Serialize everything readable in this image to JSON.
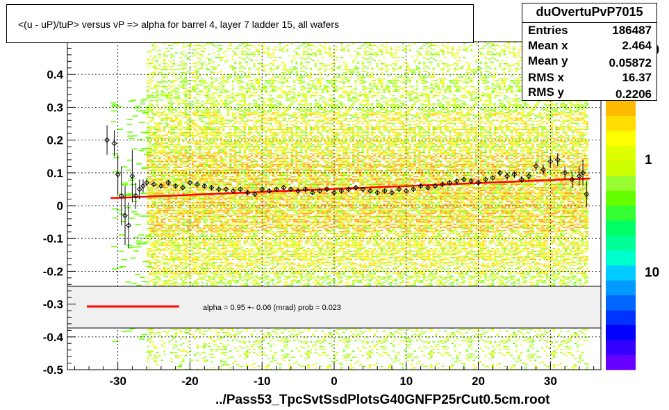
{
  "title": "<(u - uP)/tuP> versus   vP => alpha for barrel 4, layer 7 ladder 15, all wafers",
  "footer": "../Pass53_TpcSvtSsdPlotsG40GNFP25rCut0.5cm.root",
  "stats": {
    "name": "duOvertuPvP7015",
    "rows": [
      {
        "label": "Entries",
        "value": "186487"
      },
      {
        "label": "Mean x",
        "value": "2.464"
      },
      {
        "label": "Mean y",
        "value": "0.05872"
      },
      {
        "label": "RMS x",
        "value": "16.37"
      },
      {
        "label": "RMS y",
        "value": "0.2206"
      }
    ]
  },
  "legend": {
    "text": "alpha =    0.95 +-  0.06 (mrad) prob = 0.023",
    "line_color": "#ff0000"
  },
  "colorbar": {
    "labels": [
      "10",
      "1",
      "10"
    ],
    "colors": [
      "#6600ff",
      "#3300ff",
      "#0000ff",
      "#0033ff",
      "#0066ff",
      "#0099ff",
      "#00ccff",
      "#00ffcc",
      "#00ff99",
      "#00ff66",
      "#33ff33",
      "#66ff00",
      "#99ff33",
      "#ccff00",
      "#ddff00",
      "#ffff00",
      "#ffdd00",
      "#ffbb00"
    ]
  },
  "chart_data": {
    "type": "heatmap",
    "xlim": [
      -37,
      37
    ],
    "ylim": [
      -0.5,
      0.5
    ],
    "x_ticks": [
      -30,
      -20,
      -10,
      0,
      10,
      20,
      30
    ],
    "y_ticks": [
      -0.5,
      -0.4,
      -0.3,
      -0.2,
      -0.1,
      0,
      0.1,
      0.2,
      0.3,
      0.4
    ],
    "x_tick_labels": [
      "-30",
      "-20",
      "-10",
      "0",
      "10",
      "20",
      "30"
    ],
    "y_tick_labels": [
      "-0.5",
      "-0.4",
      "-0.3",
      "-0.2",
      "-0.1",
      "0",
      "0.1",
      "0.2",
      "0.3",
      "0.4"
    ],
    "grid": true,
    "heatmap_x_range": [
      -26,
      35
    ],
    "fit_line": {
      "x": [
        -31,
        35.5
      ],
      "y": [
        0.023,
        0.083
      ],
      "color": "#ff0000"
    },
    "profile": {
      "x": [
        -31.5,
        -30.5,
        -30,
        -29.5,
        -29,
        -28.5,
        -28,
        -27.5,
        -27,
        -26.5,
        -26,
        -25,
        -24,
        -23,
        -22,
        -21,
        -20,
        -19,
        -18,
        -17,
        -16,
        -15,
        -14,
        -13,
        -12,
        -11,
        -10,
        -9,
        -8,
        -7,
        -6,
        -5,
        -4,
        -3,
        -2,
        -1,
        0,
        1,
        2,
        3,
        4,
        5,
        6,
        7,
        8,
        9,
        10,
        11,
        12,
        13,
        14,
        15,
        16,
        17,
        18,
        19,
        20,
        21,
        22,
        23,
        24,
        25,
        26,
        27,
        28,
        29,
        30,
        31,
        32,
        33,
        34,
        34.5,
        35
      ],
      "y": [
        0.2,
        0.19,
        0.095,
        0.03,
        -0.03,
        -0.06,
        0.09,
        0.03,
        0.05,
        0.06,
        0.07,
        0.065,
        0.06,
        0.07,
        0.06,
        0.055,
        0.07,
        0.065,
        0.06,
        0.055,
        0.05,
        0.05,
        0.045,
        0.05,
        0.04,
        0.035,
        0.05,
        0.045,
        0.05,
        0.055,
        0.05,
        0.045,
        0.05,
        0.04,
        0.045,
        0.05,
        0.04,
        0.045,
        0.05,
        0.055,
        0.05,
        0.045,
        0.04,
        0.045,
        0.04,
        0.05,
        0.045,
        0.05,
        0.06,
        0.055,
        0.06,
        0.065,
        0.07,
        0.075,
        0.08,
        0.075,
        0.07,
        0.08,
        0.085,
        0.1,
        0.09,
        0.095,
        0.08,
        0.09,
        0.12,
        0.11,
        0.135,
        0.14,
        0.1,
        0.08,
        0.09,
        0.1,
        0.035
      ],
      "err": [
        0.045,
        0.04,
        0.06,
        0.09,
        0.09,
        0.07,
        0.08,
        0.04,
        0.03,
        0.02,
        0.01,
        0.008,
        0.008,
        0.008,
        0.008,
        0.008,
        0.008,
        0.008,
        0.008,
        0.008,
        0.008,
        0.008,
        0.008,
        0.008,
        0.008,
        0.008,
        0.008,
        0.008,
        0.008,
        0.008,
        0.008,
        0.008,
        0.008,
        0.008,
        0.008,
        0.008,
        0.008,
        0.008,
        0.008,
        0.008,
        0.008,
        0.008,
        0.008,
        0.008,
        0.008,
        0.008,
        0.008,
        0.008,
        0.008,
        0.008,
        0.008,
        0.008,
        0.008,
        0.008,
        0.008,
        0.008,
        0.008,
        0.008,
        0.008,
        0.01,
        0.01,
        0.01,
        0.01,
        0.012,
        0.015,
        0.015,
        0.018,
        0.02,
        0.02,
        0.025,
        0.03,
        0.04,
        0.04
      ]
    }
  }
}
